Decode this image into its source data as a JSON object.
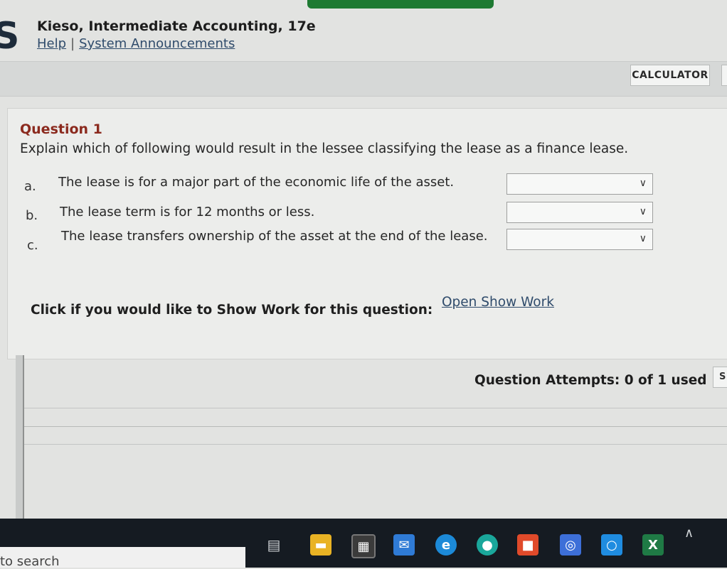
{
  "header": {
    "logo_letter": "S",
    "course_title": "Kieso, Intermediate Accounting, 17e",
    "help_link": "Help",
    "separator": "|",
    "announcements_link": "System Announcements"
  },
  "toolbar": {
    "calculator_label": "CALCULATOR"
  },
  "question": {
    "heading": "Question 1",
    "prompt": "Explain which of following would result in the lessee classifying the lease as a finance lease.",
    "options": [
      {
        "letter": "a.",
        "text": "The lease is for a major part of the economic life of the asset.",
        "selected": ""
      },
      {
        "letter": "b.",
        "text": "The lease term is for 12 months or less.",
        "selected": ""
      },
      {
        "letter": "c.",
        "text": "The lease transfers ownership of the asset at the end of the lease.",
        "selected": ""
      }
    ],
    "show_work_label": "Click if you would like to Show Work for this question:",
    "show_work_link": "Open Show Work"
  },
  "footer": {
    "attempts": "Question Attempts: 0 of 1 used",
    "side_button_label": "S"
  },
  "taskbar": {
    "search_text": "to search",
    "excel_label": "X"
  }
}
